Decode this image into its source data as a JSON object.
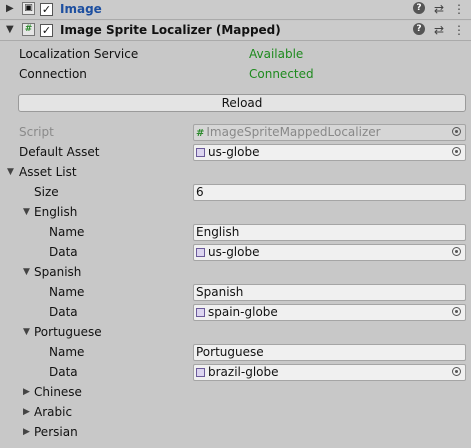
{
  "components": {
    "image": {
      "title": "Image",
      "checked": "✓"
    },
    "localizer": {
      "title": "Image Sprite Localizer (Mapped)",
      "checked": "✓"
    }
  },
  "status": {
    "service_label": "Localization Service",
    "service_value": "Available",
    "connection_label": "Connection",
    "connection_value": "Connected"
  },
  "reload_label": "Reload",
  "props": {
    "script_label": "Script",
    "script_value": "ImageSpriteMappedLocalizer",
    "default_asset_label": "Default Asset",
    "default_asset_value": "us-globe",
    "asset_list_label": "Asset List",
    "size_label": "Size",
    "size_value": "6"
  },
  "assets": [
    {
      "title": "English",
      "name_label": "Name",
      "name_value": "English",
      "data_label": "Data",
      "data_value": "us-globe"
    },
    {
      "title": "Spanish",
      "name_label": "Name",
      "name_value": "Spanish",
      "data_label": "Data",
      "data_value": "spain-globe"
    },
    {
      "title": "Portuguese",
      "name_label": "Name",
      "name_value": "Portuguese",
      "data_label": "Data",
      "data_value": "brazil-globe"
    }
  ],
  "collapsed_assets": [
    "Chinese",
    "Arabic",
    "Persian"
  ],
  "icons": {
    "fold_open": "▼",
    "fold_closed": "▶",
    "help": "?",
    "presets": "⇄",
    "menu": "⋮",
    "script_mark": "#"
  },
  "colors": {
    "status_green": "#1e8a1e",
    "title_blue": "#1d4fa0"
  }
}
